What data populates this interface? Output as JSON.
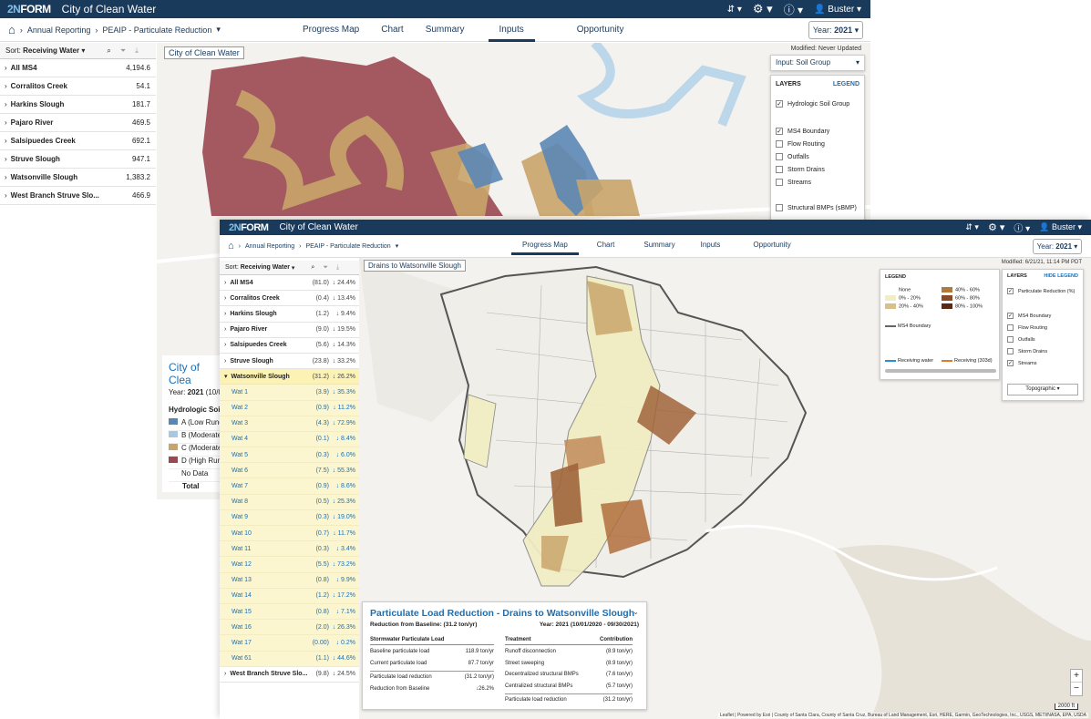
{
  "app": {
    "logo_a": "2N",
    "logo_b": "FORM",
    "title": "City of Clean Water",
    "user": "Buster"
  },
  "colors": {
    "topbar": "#1a3a5c",
    "accent": "#1a6fb6",
    "soil_a": "#5b87b5",
    "soil_b": "#a9c7e0",
    "soil_c": "#c9a46a",
    "soil_d": "#9b4851"
  },
  "nav": {
    "crumb1": "Annual Reporting",
    "crumb2": "PEAIP - Particulate Reduction",
    "tabs": [
      "Progress Map",
      "Chart",
      "Summary",
      "Inputs",
      "Opportunity"
    ],
    "year_label": "Year:",
    "year": "2021"
  },
  "back": {
    "active_tab": "Inputs",
    "sort_label": "Sort:",
    "sort_value": "Receiving Water",
    "rows": [
      {
        "name": "All MS4",
        "v": "4,194.6"
      },
      {
        "name": "Corralitos Creek",
        "v": "54.1"
      },
      {
        "name": "Harkins Slough",
        "v": "181.7"
      },
      {
        "name": "Pajaro River",
        "v": "469.5"
      },
      {
        "name": "Salsipuedes Creek",
        "v": "692.1"
      },
      {
        "name": "Struve Slough",
        "v": "947.1"
      },
      {
        "name": "Watsonville Slough",
        "v": "1,383.2"
      },
      {
        "name": "West Branch Struve Slo...",
        "v": "466.9"
      }
    ],
    "map_label": "City of Clean Water",
    "modified": "Modified: Never Updated",
    "input_select": "Input: Soil Group",
    "layers_title": "LAYERS",
    "legend_link": "LEGEND",
    "layers": [
      {
        "label": "Hydrologic Soil Group",
        "checked": true
      },
      {
        "label": "MS4 Boundary",
        "checked": true
      },
      {
        "label": "Flow Routing",
        "checked": false
      },
      {
        "label": "Outfalls",
        "checked": false
      },
      {
        "label": "Storm Drains",
        "checked": false
      },
      {
        "label": "Streams",
        "checked": false
      },
      {
        "label": "Structural BMPs (sBMP)",
        "checked": false
      }
    ],
    "info_title": "City of Clea",
    "info_year_label": "Year:",
    "info_year": "2021",
    "info_year_rest": "(10/0",
    "soil_title": "Hydrologic Soil G",
    "soil_rows": [
      "A (Low Runof",
      "B (Moderatel",
      "C (Moderatel",
      "D (High Runo",
      "No Data",
      "Total"
    ]
  },
  "front": {
    "active_tab": "Progress Map",
    "sort_label": "Sort:",
    "sort_value": "Receiving Water",
    "rows_top": [
      {
        "name": "All MS4",
        "v0": "(81.0)",
        "v1": "↓ 24.4%"
      },
      {
        "name": "Corralitos Creek",
        "v0": "(0.4)",
        "v1": "↓ 13.4%"
      },
      {
        "name": "Harkins Slough",
        "v0": "(1.2)",
        "v1": "↓ 9.4%"
      },
      {
        "name": "Pajaro River",
        "v0": "(9.0)",
        "v1": "↓ 19.5%"
      },
      {
        "name": "Salsipuedes Creek",
        "v0": "(5.6)",
        "v1": "↓ 14.3%"
      },
      {
        "name": "Struve Slough",
        "v0": "(23.8)",
        "v1": "↓ 33.2%"
      },
      {
        "name": "Watsonville Slough",
        "v0": "(31.2)",
        "v1": "↓ 26.2%"
      }
    ],
    "rows_sub": [
      {
        "name": "Wat 1",
        "v0": "(3.9)",
        "v1": "↓ 35.3%"
      },
      {
        "name": "Wat 2",
        "v0": "(0.9)",
        "v1": "↓ 11.2%"
      },
      {
        "name": "Wat 3",
        "v0": "(4.3)",
        "v1": "↓ 72.9%"
      },
      {
        "name": "Wat 4",
        "v0": "(0.1)",
        "v1": "↓ 8.4%"
      },
      {
        "name": "Wat 5",
        "v0": "(0.3)",
        "v1": "↓ 6.0%"
      },
      {
        "name": "Wat 6",
        "v0": "(7.5)",
        "v1": "↓ 55.3%"
      },
      {
        "name": "Wat 7",
        "v0": "(0.9)",
        "v1": "↓ 8.6%"
      },
      {
        "name": "Wat 8",
        "v0": "(0.5)",
        "v1": "↓ 25.3%"
      },
      {
        "name": "Wat 9",
        "v0": "(0.3)",
        "v1": "↓ 19.0%"
      },
      {
        "name": "Wat 10",
        "v0": "(0.7)",
        "v1": "↓ 11.7%"
      },
      {
        "name": "Wat 11",
        "v0": "(0.3)",
        "v1": "↓ 3.4%"
      },
      {
        "name": "Wat 12",
        "v0": "(5.5)",
        "v1": "↓ 73.2%"
      },
      {
        "name": "Wat 13",
        "v0": "(0.8)",
        "v1": "↓ 9.9%"
      },
      {
        "name": "Wat 14",
        "v0": "(1.2)",
        "v1": "↓ 17.2%"
      },
      {
        "name": "Wat 15",
        "v0": "(0.8)",
        "v1": "↓ 7.1%"
      },
      {
        "name": "Wat 16",
        "v0": "(2.0)",
        "v1": "↓ 26.3%"
      },
      {
        "name": "Wat 17",
        "v0": "(0.00)",
        "v1": "↓ 0.2%"
      },
      {
        "name": "Wat 61",
        "v0": "(1.1)",
        "v1": "↓ 44.6%"
      }
    ],
    "row_last": {
      "name": "West Branch Struve Slo...",
      "v0": "(9.8)",
      "v1": "↓ 24.5%"
    },
    "map_label": "Drains to Watsonville Slough",
    "modified": "Modified: 6/21/21, 11:14 PM PDT",
    "legend_title": "LEGEND",
    "legend_items": [
      "None",
      "0% - 20%",
      "20% - 40%",
      "40% - 60%",
      "60% - 80%",
      "80% - 100%"
    ],
    "legend_lines": [
      "MS4 Boundary",
      "Receiving water",
      "Receiving (303d)"
    ],
    "layers_title": "LAYERS",
    "hide_legend": "HIDE LEGEND",
    "layers": [
      {
        "label": "Particulate Reduction (%)",
        "checked": true
      },
      {
        "label": "MS4 Boundary",
        "checked": true
      },
      {
        "label": "Flow Routing",
        "checked": false
      },
      {
        "label": "Outfalls",
        "checked": false
      },
      {
        "label": "Storm Drains",
        "checked": false
      },
      {
        "label": "Streams",
        "checked": true
      }
    ],
    "basemap": "Topographic",
    "zoom_in": "+",
    "zoom_out": "−",
    "scale": "2000 ft",
    "attribution": "Leaflet | Powered by Esri | County of Santa Clara, County of Santa Cruz, Bureau of Land Management, Esri, HERE, Garmin, GeoTechnologies, Inc., USGS, METI/NASA, EPA, USDA",
    "card": {
      "title": "Particulate Load Reduction - Drains to Watsonville Slough",
      "subtitle": "Reduction from Baseline: (31.2 ton/yr)",
      "year_label": "Year:",
      "year": "2021",
      "year_range": "(10/01/2020 - 09/30/2021)",
      "left_header": "Stormwater Particulate Load",
      "left_rows": [
        {
          "k": "Baseline particulate load",
          "v": "118.9 ton/yr"
        },
        {
          "k": "Current particulate load",
          "v": "87.7 ton/yr"
        },
        {
          "k": "Particulate load reduction",
          "v": "(31.2 ton/yr)"
        },
        {
          "k": "Reduction from Baseline",
          "v": "↓26.2%"
        }
      ],
      "right_header_a": "Treatment",
      "right_header_b": "Contribution",
      "right_rows": [
        {
          "k": "Runoff disconnection",
          "v": "(8.9 ton/yr)"
        },
        {
          "k": "Street sweeping",
          "v": "(8.9 ton/yr)"
        },
        {
          "k": "Decentralized structural BMPs",
          "v": "(7.6 ton/yr)"
        },
        {
          "k": "Centralized structural BMPs",
          "v": "(5.7 ton/yr)"
        },
        {
          "k": "Particulate load reduction",
          "v": "(31.2 ton/yr)"
        }
      ]
    }
  }
}
